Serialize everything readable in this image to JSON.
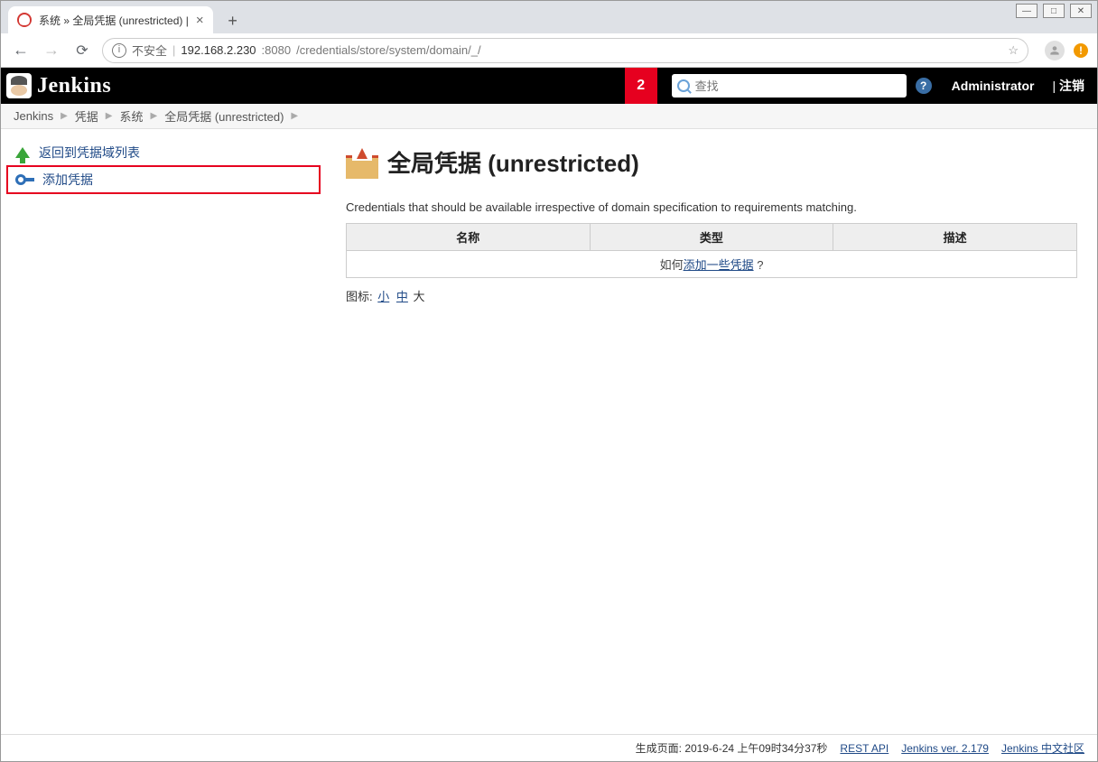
{
  "browser": {
    "tab_title": "系统 » 全局凭据 (unrestricted) |",
    "insecure_label": "不安全",
    "url_host": "192.168.2.230",
    "url_port": ":8080",
    "url_path": "/credentials/store/system/domain/_/"
  },
  "header": {
    "logo_text": "Jenkins",
    "notification_count": "2",
    "search_placeholder": "查找",
    "user": "Administrator",
    "logout": "注销"
  },
  "breadcrumbs": [
    "Jenkins",
    "凭据",
    "系统",
    "全局凭据 (unrestricted)"
  ],
  "sidebar": {
    "back_label": "返回到凭据域列表",
    "add_label": "添加凭据"
  },
  "main": {
    "title": "全局凭据 (unrestricted)",
    "description": "Credentials that should be available irrespective of domain specification to requirements matching.",
    "table": {
      "headers": [
        "名称",
        "类型",
        "描述"
      ],
      "empty_prefix": "如何",
      "empty_link": "添加一些凭据",
      "empty_suffix": " ?"
    },
    "iconsize": {
      "label": "图标:",
      "small": "小",
      "medium": "中",
      "large": "大"
    }
  },
  "footer": {
    "generated_label": "生成页面",
    "generated_time": "2019-6-24 上午09时34分37秒",
    "rest_api": "REST API",
    "version": "Jenkins ver. 2.179",
    "community": "Jenkins 中文社区"
  }
}
